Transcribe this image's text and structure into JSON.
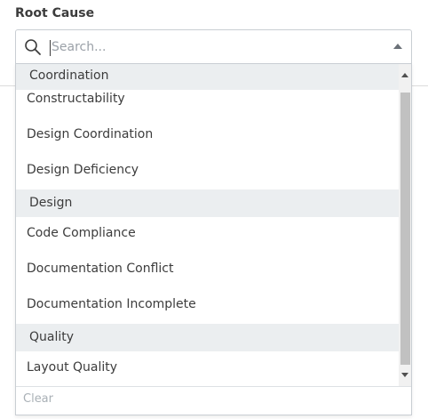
{
  "field": {
    "label": "Root Cause"
  },
  "search": {
    "value": "",
    "placeholder": "Search..."
  },
  "groups": [
    {
      "label": "Coordination",
      "options": [
        "Constructability",
        "Design Coordination",
        "Design Deficiency"
      ]
    },
    {
      "label": "Design",
      "options": [
        "Code Compliance",
        "Documentation Conflict",
        "Documentation Incomplete"
      ]
    },
    {
      "label": "Quality",
      "options": [
        "Layout Quality"
      ]
    }
  ],
  "footer": {
    "clear_label": "Clear"
  },
  "icons": {
    "search": "search-icon",
    "collapse": "chevron-up-icon",
    "scroll_up": "scroll-up-arrow-icon",
    "scroll_down": "scroll-down-arrow-icon"
  },
  "colors": {
    "group_header_bg": "#ebeef0",
    "text": "#3c3c3c",
    "placeholder": "#9ba1a8",
    "clear_text": "#a9b0b6",
    "border": "#c9ced3",
    "scroll_thumb": "#c1c1c1"
  }
}
